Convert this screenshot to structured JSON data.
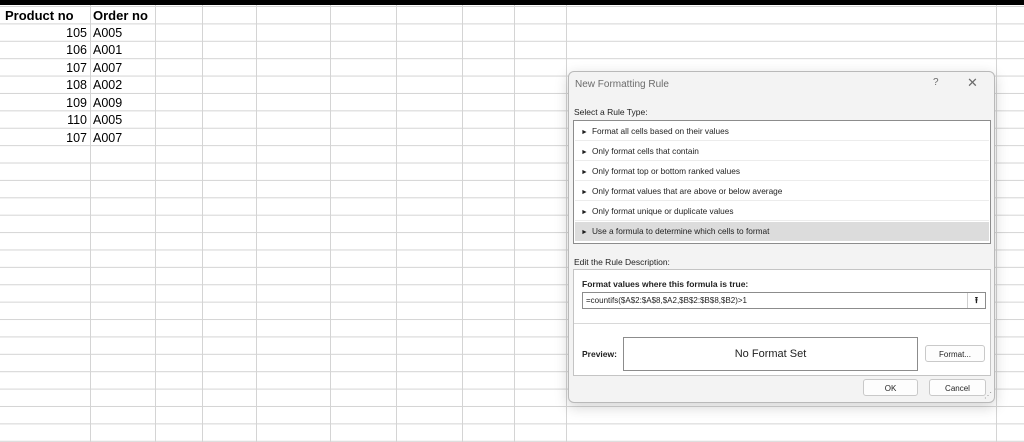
{
  "sheet": {
    "header": {
      "col_a": "Product no",
      "col_b": "Order no"
    },
    "rows": [
      {
        "product": "105",
        "order": "A005"
      },
      {
        "product": "106",
        "order": "A001"
      },
      {
        "product": "107",
        "order": "A007"
      },
      {
        "product": "108",
        "order": "A002"
      },
      {
        "product": "109",
        "order": "A009"
      },
      {
        "product": "110",
        "order": "A005"
      },
      {
        "product": "107",
        "order": "A007"
      }
    ]
  },
  "dialog": {
    "title": "New Formatting Rule",
    "help_glyph": "?",
    "close_glyph": "✕",
    "rule_type_label": "Select a Rule Type:",
    "rule_types": [
      "Format all cells based on their values",
      "Only format cells that contain",
      "Only format top or bottom ranked values",
      "Only format values that are above or below average",
      "Only format unique or duplicate values",
      "Use a formula to determine which cells to format"
    ],
    "selected_rule_index": 5,
    "description_label": "Edit the Rule Description:",
    "formula_label": "Format values where this formula is true:",
    "formula_value": "=countifs($A$2:$A$8,$A2,$B$2:$B$8,$B2)>1",
    "preview_label": "Preview:",
    "preview_text": "No Format Set",
    "format_button": "Format...",
    "ok_button": "OK",
    "cancel_button": "Cancel"
  }
}
